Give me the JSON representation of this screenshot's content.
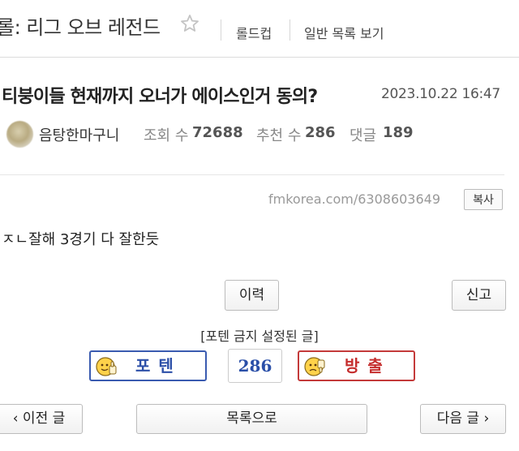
{
  "header": {
    "board_title": "롤: 리그 오브 레전드",
    "tabs": [
      "롤드컵",
      "일반 목록 보기"
    ]
  },
  "post": {
    "title": "티붕이들 현재까지 오너가 에이스인거 동의?",
    "date": "2023.10.22 16:47",
    "author": "음탕한마구니",
    "views_label": "조회 수",
    "views": "72688",
    "recommend_label": "추천 수",
    "recommend": "286",
    "comments_label": "댓글",
    "comments": "189",
    "link": "fmkorea.com/6308603649",
    "copy_label": "복사",
    "body": "ㅈㄴ잘해 3경기 다 잘한듯"
  },
  "actions": {
    "history_label": "이력",
    "report_label": "신고",
    "vote_caption": "[포텐 금지 설정된 글]",
    "upvote_label": "포텐",
    "vote_count": "286",
    "downvote_label": "방출",
    "prev_label": "‹ 이전 글",
    "list_label": "목록으로",
    "next_label": "다음 글 ›"
  },
  "colors": {
    "upvote": "#3a5bb0",
    "downvote": "#c43a3a",
    "count": "#2a4fa8"
  }
}
